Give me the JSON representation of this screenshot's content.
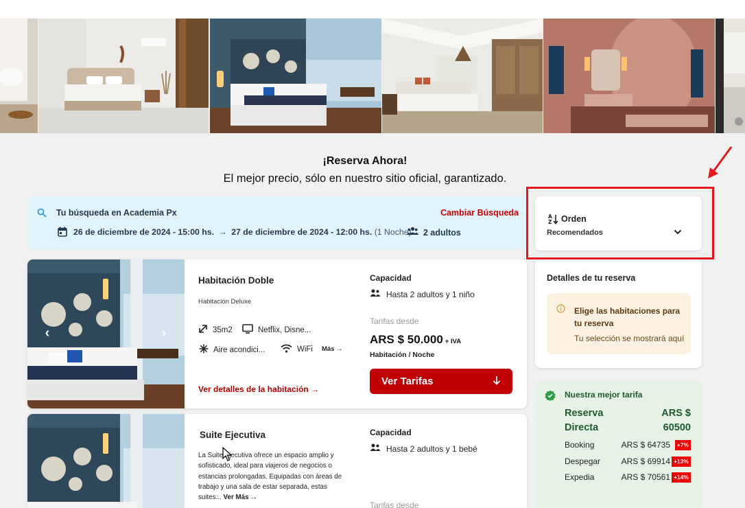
{
  "hero": {
    "title": "¡Reserva Ahora!",
    "subtitle": "El mejor precio, sólo en nuestro sitio oficial, garantizado."
  },
  "search": {
    "label": "Tu búsqueda en Academia Px",
    "change_label": "Cambiar Búsqueda",
    "checkin": "26 de diciembre de 2024 - 15:00 hs.",
    "checkout": "27 de diciembre de 2024 - 12:00 hs.",
    "nights": "(1 Noche)",
    "guests": "2 adultos",
    "icons": [
      "search-icon",
      "calendar-icon",
      "arrow-right-icon",
      "people-icon"
    ]
  },
  "order": {
    "label": "Orden",
    "value": "Recomendados",
    "icons": [
      "sort-icon",
      "chevron-down-icon"
    ]
  },
  "rooms": [
    {
      "name": "Habitación Doble",
      "type": "Habitación Deluxe",
      "features": {
        "size": "35m2",
        "tv": "Netflix, Disne...",
        "ac": "Aire acondici...",
        "wifi": "WiFi",
        "more": "Más"
      },
      "details_link": "Ver detalles de la habitación",
      "capacity_label": "Capacidad",
      "capacity": "Hasta 2 adultos y 1 niño",
      "rates_from": "Tarifas desde",
      "price": "ARS $ 50.000",
      "tax": "+ IVA",
      "price_unit": "Habitación / Noche",
      "button": "Ver Tarifas"
    },
    {
      "name": "Suite Ejecutiva",
      "description": "La Suite Ejecutiva ofrece un espacio amplio y sofisticado, ideal para viajeros de negocios o estancias prolongadas. Equipadas con áreas de trabajo y una sala de estar separada, estas suites...",
      "more": "Ver Más",
      "capacity_label": "Capacidad",
      "capacity": "Hasta 2 adultos y 1 bebé",
      "rates_from": "Tarifas desde"
    }
  ],
  "reservation": {
    "title": "Detalles de tu reserva",
    "prompt": "Elige las habitaciones para tu reserva",
    "note": "Tu selección se mostrará aquí"
  },
  "best_rate": {
    "title": "Nuestra mejor tarifa",
    "direct_label_1": "Reserva",
    "direct_label_2": "Directa",
    "direct_price_1": "ARS $",
    "direct_price_2": "60500",
    "competitors": [
      {
        "name": "Booking",
        "price": "ARS $ 64735",
        "diff": "+7%"
      },
      {
        "name": "Despegar",
        "price": "ARS $ 69914",
        "diff": "+13%"
      },
      {
        "name": "Expedia",
        "price": "ARS $ 70561",
        "diff": "+14%"
      }
    ]
  },
  "colors": {
    "accent_red": "#c10006",
    "search_bg": "#e3f3fb",
    "best_rate_bg": "#e7f2e7",
    "notice_bg": "#fdf1e1",
    "annotation_red": "#e3191d"
  }
}
